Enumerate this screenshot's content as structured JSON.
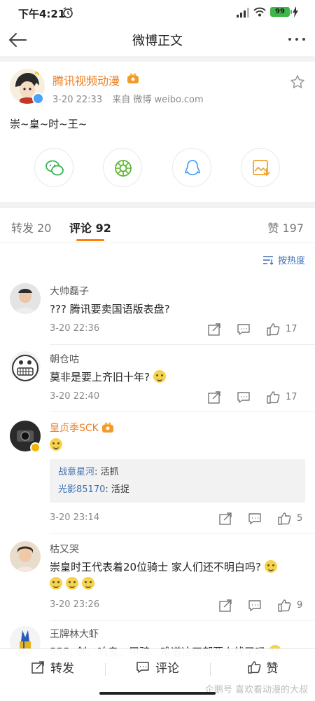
{
  "status_bar": {
    "time": "下午4:21",
    "battery": "99"
  },
  "nav": {
    "title": "微博正文"
  },
  "post": {
    "author": "腾讯视频动漫",
    "date": "3-20 22:33",
    "source": "来自 微博 weibo.com",
    "text": "崇~皇~时~王~"
  },
  "tabs": {
    "repost_label": "转发",
    "repost_count": "20",
    "comment_label": "评论",
    "comment_count": "92",
    "like_label": "赞",
    "like_count": "197"
  },
  "sort": {
    "label": "按热度"
  },
  "comments": [
    {
      "name": "大帅磊子",
      "text": "??? 腾讯要卖国语版表盘?",
      "time": "3-20 22:36",
      "likes": "17"
    },
    {
      "name": "朝仓咕",
      "text": "莫非是要上齐旧十年?",
      "time": "3-20 22:40",
      "likes": "17"
    },
    {
      "name": "皇贞季SCK",
      "text": "",
      "time": "3-20 23:14",
      "likes": "5",
      "replies": [
        {
          "user": "战意星河",
          "text": ": 活抓"
        },
        {
          "user": "光影85170",
          "text": ": 活捉"
        }
      ]
    },
    {
      "name": "枯又哭",
      "text": "崇皇时王代表着20位骑士 家人们还不明白吗?",
      "time": "3-20 23:26",
      "likes": "9"
    },
    {
      "name": "王牌林大虾",
      "text": "555, 剑、响鬼、甲骑、难道这四部要上线了吗",
      "time": "",
      "likes": ""
    }
  ],
  "bottom_bar": {
    "repost": "转发",
    "comment": "评论",
    "like": "赞"
  },
  "watermark": "企鹅号 喜欢看动漫的大叔",
  "colors": {
    "accent": "#ff8200",
    "link": "#3b6fb5",
    "vip_name": "#f07d20"
  }
}
